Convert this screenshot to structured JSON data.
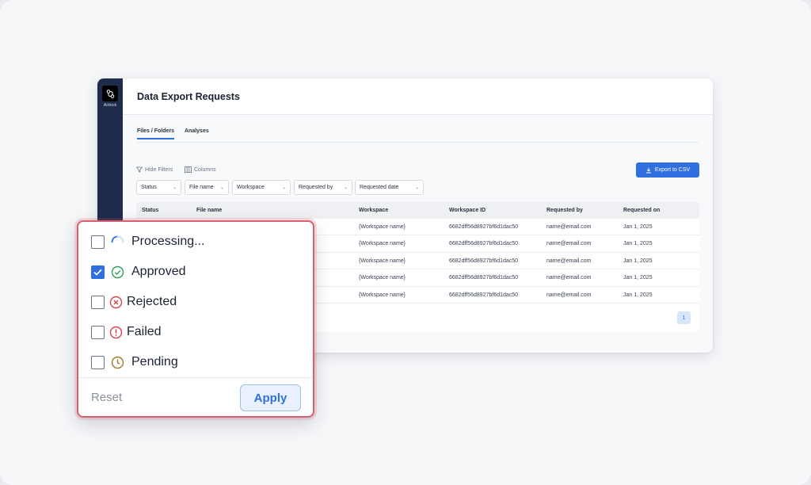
{
  "app": {
    "brand": "Airlock",
    "page_title": "Data Export Requests",
    "tabs": [
      {
        "label": "Files / Folders",
        "active": true
      },
      {
        "label": "Analyses",
        "active": false
      }
    ],
    "toolbar": {
      "hide_filters": "Hide Filters",
      "columns": "Columns",
      "export": "Export to CSV"
    },
    "filters": [
      "Status",
      "File name",
      "Workspace",
      "Requested by",
      "Requested date"
    ],
    "table": {
      "headers": [
        "Status",
        "File name",
        "Workspace",
        "Workspace ID",
        "Requested by",
        "Requested on"
      ],
      "rows": [
        {
          "workspace": "{Workspace name}",
          "workspace_id": "6682dff56d8927bf6d1dac50",
          "requested_by": "name@email.com",
          "requested_on": "Jan 1, 2025"
        },
        {
          "workspace": "{Workspace name}",
          "workspace_id": "6682dff56d8927bf6d1dac50",
          "requested_by": "name@email.com",
          "requested_on": "Jan 1, 2025"
        },
        {
          "workspace": "{Workspace name}",
          "workspace_id": "6682dff56d8927bf6d1dac50",
          "requested_by": "name@email.com",
          "requested_on": "Jan 1, 2025"
        },
        {
          "workspace": "{Workspace name}",
          "workspace_id": "6682dff56d8927bf6d1dac50",
          "requested_by": "name@email.com",
          "requested_on": "Jan 1, 2025"
        },
        {
          "workspace": "{Workspace name}",
          "workspace_id": "6682dff56d8927bf6d1dac50",
          "requested_by": "name@email.com",
          "requested_on": "Jan 1, 2025"
        }
      ]
    },
    "pagination": {
      "current_page": "1"
    }
  },
  "status_popover": {
    "options": [
      {
        "label": "Processing...",
        "checked": false,
        "icon": "spinner-icon",
        "color": "#2f6fe0"
      },
      {
        "label": "Approved",
        "checked": true,
        "icon": "check-circle-icon",
        "color": "#2e9e5b"
      },
      {
        "label": "Rejected",
        "checked": false,
        "icon": "x-circle-icon",
        "color": "#d64553"
      },
      {
        "label": "Failed",
        "checked": false,
        "icon": "alert-circle-icon",
        "color": "#d64553"
      },
      {
        "label": "Pending",
        "checked": false,
        "icon": "clock-icon",
        "color": "#a07a2a"
      }
    ],
    "reset_label": "Reset",
    "apply_label": "Apply"
  },
  "colors": {
    "accent": "#2f6fe0",
    "sidebar": "#1e2b4a",
    "popover_border": "#d8606e"
  }
}
